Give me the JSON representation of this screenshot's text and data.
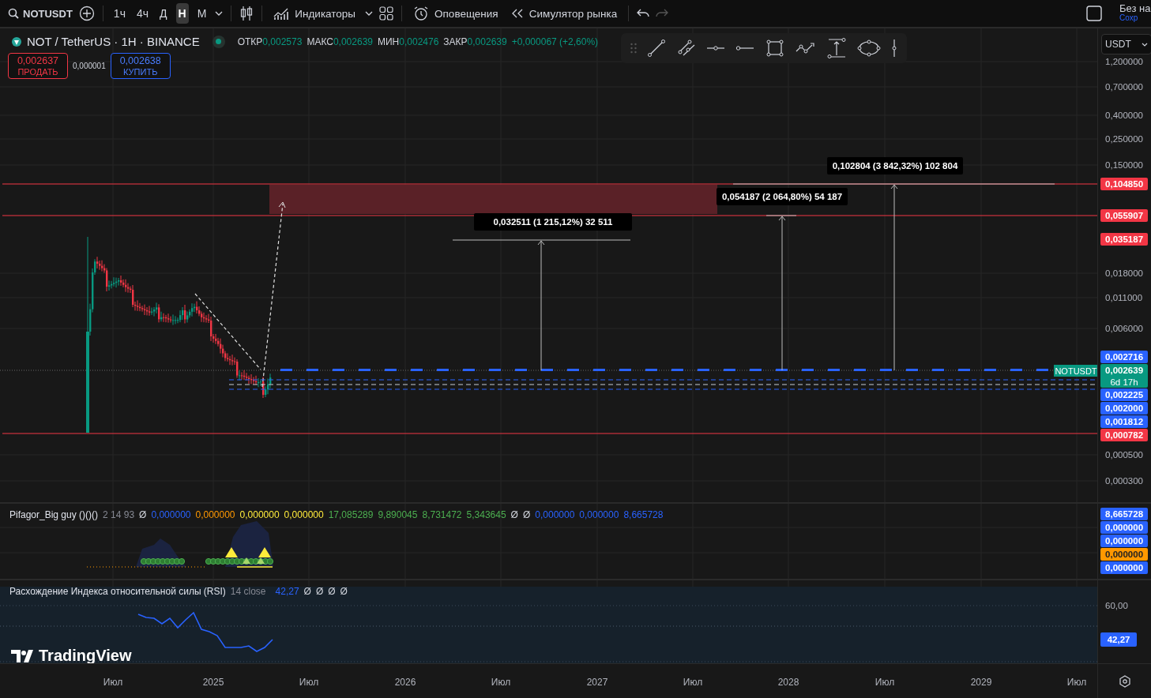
{
  "toolbar": {
    "symbol": "NOTUSDT",
    "intervals": [
      {
        "label": "1ч",
        "selected": false
      },
      {
        "label": "4ч",
        "selected": false
      },
      {
        "label": "Д",
        "selected": false
      },
      {
        "label": "Н",
        "selected": true
      },
      {
        "label": "М",
        "selected": false
      }
    ],
    "indicators_label": "Индикаторы",
    "alerts_label": "Оповещения",
    "replay_label": "Симулятор рынка",
    "layout": {
      "title": "Без на",
      "subtitle": "Сохр"
    }
  },
  "legend": {
    "title": "NOT / TetherUS · 1H · BINANCE",
    "market_open": true,
    "ohlc": [
      {
        "label": "ОТКР",
        "value": "0,002573"
      },
      {
        "label": "МАКС",
        "value": "0,002639"
      },
      {
        "label": "МИН",
        "value": "0,002476"
      },
      {
        "label": "ЗАКР",
        "value": "0,002639"
      }
    ],
    "change": "+0,000067 (+2,60%)"
  },
  "trade": {
    "sell_price": "0,002637",
    "sell_label": "ПРОДАТЬ",
    "spread": "0,000001",
    "buy_price": "0,002638",
    "buy_label": "КУПИТЬ"
  },
  "currency": "USDT",
  "measurements": [
    "0,032511 (1 215,12%) 32 511",
    "0,054187 (2 064,80%) 54 187",
    "0,102804 (3 842,32%) 102 804"
  ],
  "symbol_tag": "NOTUSDT",
  "price_axis": {
    "ticks": [
      "1,200000",
      "0,700000",
      "0,400000",
      "0,250000",
      "0,150000",
      "0,018000",
      "0,011000",
      "0,006000",
      "0,000500",
      "0,000300"
    ],
    "labels": [
      {
        "text": "0,104850",
        "color": "#f23645"
      },
      {
        "text": "0,055907",
        "color": "#f23645"
      },
      {
        "text": "0,035187",
        "color": "#f23645"
      },
      {
        "text": "0,002716",
        "color": "#2962ff"
      },
      {
        "text": "0,002639",
        "sub": "6d 17h",
        "color": "#089981"
      },
      {
        "text": "0,002225",
        "color": "#2962ff"
      },
      {
        "text": "0,002000",
        "color": "#2962ff"
      },
      {
        "text": "0,001812",
        "color": "#2962ff"
      },
      {
        "text": "0,000782",
        "color": "#f23645"
      }
    ]
  },
  "indicator": {
    "name": "Pifagor_Big guy ()()()",
    "params": "2 14 93",
    "values": [
      {
        "text": "Ø",
        "color": "#d1d4dc"
      },
      {
        "text": "0,000000",
        "color": "#2962ff"
      },
      {
        "text": "0,000000",
        "color": "#ff9800"
      },
      {
        "text": "0,000000",
        "color": "#ffeb3b"
      },
      {
        "text": "0,000000",
        "color": "#ffeb3b"
      },
      {
        "text": "17,085289",
        "color": "#4caf50"
      },
      {
        "text": "9,890045",
        "color": "#4caf50"
      },
      {
        "text": "8,731472",
        "color": "#4caf50"
      },
      {
        "text": "5,343645",
        "color": "#4caf50"
      },
      {
        "text": "Ø",
        "color": "#d1d4dc"
      },
      {
        "text": "Ø",
        "color": "#d1d4dc"
      },
      {
        "text": "0,000000",
        "color": "#2962ff"
      },
      {
        "text": "0,000000",
        "color": "#2962ff"
      },
      {
        "text": "8,665728",
        "color": "#2962ff"
      }
    ],
    "axis_labels": [
      {
        "text": "8,665728",
        "color": "#2962ff"
      },
      {
        "text": "0,000000",
        "color": "#2962ff"
      },
      {
        "text": "0,000000",
        "color": "#2962ff"
      },
      {
        "text": "0,000000",
        "color": "#ff9800"
      },
      {
        "text": "0,000000",
        "color": "#2962ff"
      }
    ]
  },
  "rsi": {
    "name": "Расхождение Индекса относительной силы (RSI)",
    "params": "14 close",
    "value": "42,27",
    "extras": [
      "Ø",
      "Ø",
      "Ø",
      "Ø"
    ],
    "axis_tick": "60,00",
    "axis_label": "42,27"
  },
  "brand": "TradingView",
  "time_axis": [
    "Июл",
    "2025",
    "Июл",
    "2026",
    "Июл",
    "2027",
    "Июл",
    "2028",
    "Июл",
    "2029",
    "Июл"
  ]
}
